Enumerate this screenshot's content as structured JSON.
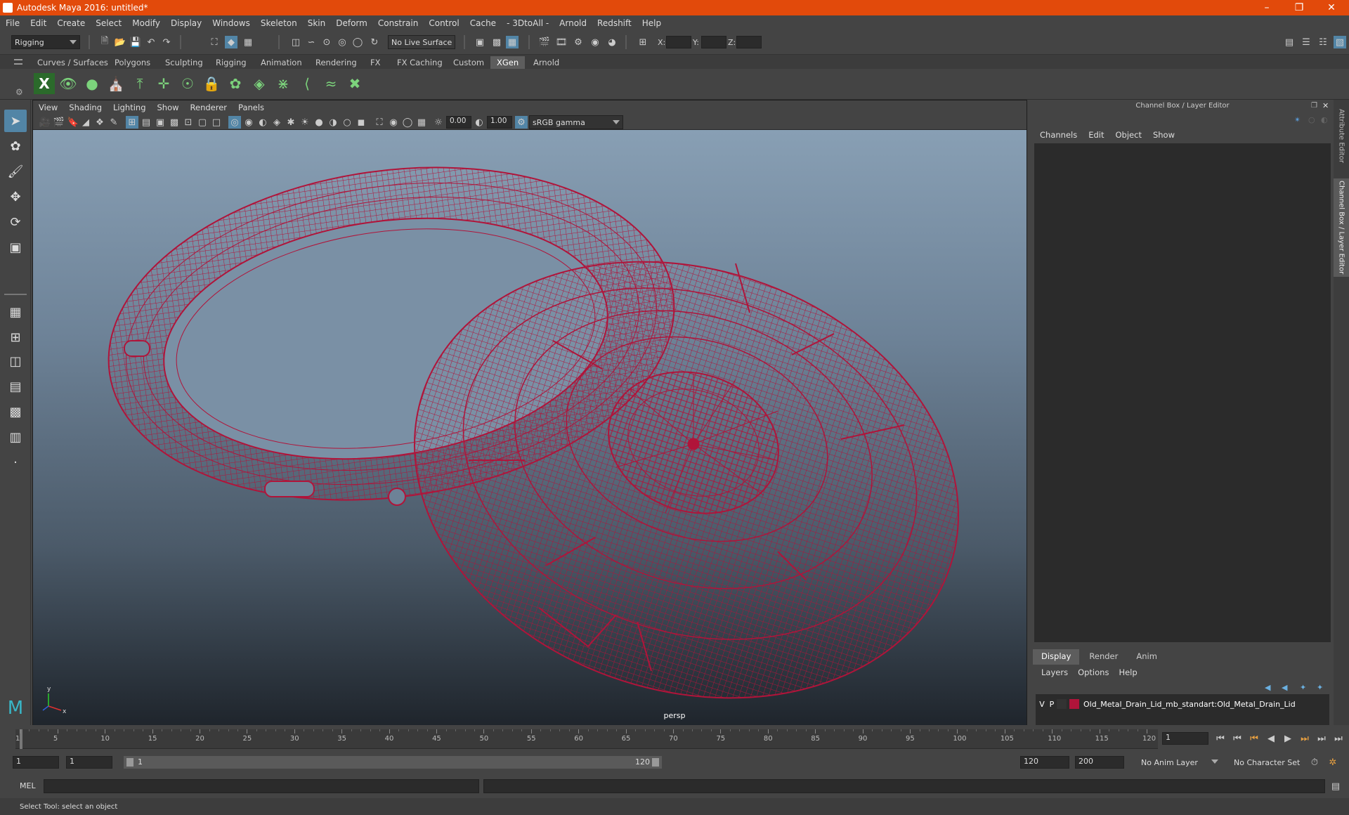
{
  "window": {
    "title": "Autodesk Maya 2016: untitled*"
  },
  "menu": [
    "File",
    "Edit",
    "Create",
    "Select",
    "Modify",
    "Display",
    "Windows",
    "Skeleton",
    "Skin",
    "Deform",
    "Constrain",
    "Control",
    "Cache",
    "- 3DtoAll -",
    "Arnold",
    "Redshift",
    "Help"
  ],
  "statusline": {
    "menuset": "Rigging",
    "live_surface": "No Live Surface",
    "x_label": "X:",
    "y_label": "Y:",
    "z_label": "Z:"
  },
  "shelf_tabs": [
    "Curves / Surfaces",
    "Polygons",
    "Sculpting",
    "Rigging",
    "Animation",
    "Rendering",
    "FX",
    "FX Caching",
    "Custom",
    "XGen",
    "Arnold"
  ],
  "shelf_active": "XGen",
  "viewport": {
    "menu": [
      "View",
      "Shading",
      "Lighting",
      "Show",
      "Renderer",
      "Panels"
    ],
    "exposure": "0.00",
    "gamma": "1.00",
    "color_space": "sRGB gamma",
    "camera": "persp"
  },
  "channel_box": {
    "title": "Channel Box / Layer Editor",
    "menu": [
      "Channels",
      "Edit",
      "Object",
      "Show"
    ]
  },
  "layer_editor": {
    "tabs": [
      "Display",
      "Render",
      "Anim"
    ],
    "active_tab": "Display",
    "menu": [
      "Layers",
      "Options",
      "Help"
    ],
    "layer": {
      "v": "V",
      "p": "P",
      "name": "Old_Metal_Drain_Lid_mb_standart:Old_Metal_Drain_Lid",
      "color": "#b0143a"
    }
  },
  "side_tabs": {
    "attribute_editor": "Attribute Editor",
    "channel_box": "Channel Box / Layer Editor"
  },
  "time_slider": {
    "ticks": [
      "1",
      "5",
      "10",
      "15",
      "20",
      "25",
      "30",
      "35",
      "40",
      "45",
      "50",
      "55",
      "60",
      "65",
      "70",
      "75",
      "80",
      "85",
      "90",
      "95",
      "100",
      "105",
      "110",
      "115",
      "120"
    ],
    "current_frame": "1"
  },
  "range_slider": {
    "start": "1",
    "playback_start": "1",
    "range_start": "1",
    "range_end": "120",
    "playback_end": "120",
    "end": "200",
    "anim_layer": "No Anim Layer",
    "character_set": "No Character Set"
  },
  "command_line": {
    "language": "MEL"
  },
  "help_line": "Select Tool: select an object",
  "colors": {
    "title_bar": "#e24a0b",
    "wireframe": "#b0143a",
    "selected_tool": "#5285a6"
  }
}
